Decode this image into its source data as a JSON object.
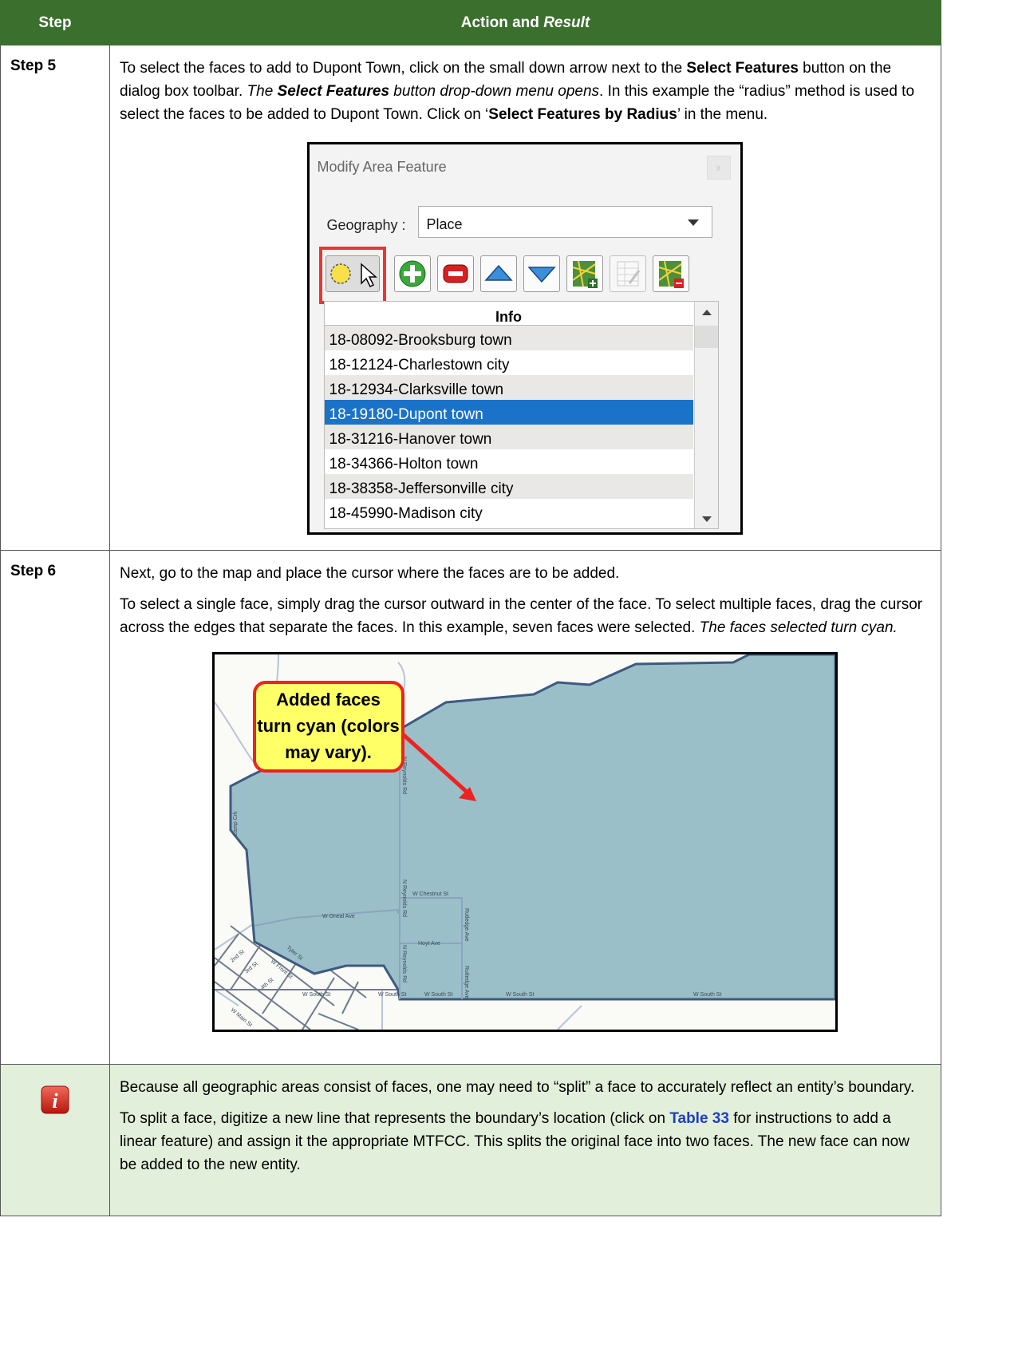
{
  "header": {
    "col_step": "Step",
    "col_action_prefix": "Action and ",
    "col_action_result": "Result"
  },
  "step5": {
    "label": "Step 5",
    "t1": "To select the faces to add to Dupont Town, click on the small down arrow next to the ",
    "b1": "Select Features",
    "t2": " button on the dialog box toolbar. ",
    "i1": "The ",
    "bi1": "Select Features",
    "i2": " button drop-down menu opens",
    "t3": ". In this example the “radius” method is used to select the faces to be added to Dupont Town. Click on ‘",
    "b2": "Select Features by Radius",
    "t4": "’ in the menu."
  },
  "dialog": {
    "title": "Modify Area Feature",
    "close": "x",
    "geo_label": "Geography :",
    "geo_value": "Place",
    "info_header": "Info",
    "items": [
      "18-08092-Brooksburg town",
      "18-12124-Charlestown city",
      "18-12934-Clarksville town",
      "18-19180-Dupont town",
      "18-31216-Hanover town",
      "18-34366-Holton town",
      "18-38358-Jeffersonville city",
      "18-45990-Madison city"
    ]
  },
  "step6": {
    "label": "Step 6",
    "p1": "Next, go to the map and place the cursor where the faces are to be added.",
    "p2": "To select a single face, simply drag the cursor outward in the center of the face. To select multiple faces, drag the cursor across the edges that separate the faces. In this example, seven faces were selected. ",
    "p2_italic": "The faces selected turn cyan."
  },
  "map": {
    "callout_l1": "Added faces",
    "callout_l2": "turn cyan (colors",
    "callout_l3": "may vary).",
    "streets": {
      "chestnut": "W Chestnut St",
      "oneal": "W Oneal Ave",
      "hoyt": "Hoyt Ave",
      "south1": "W South St",
      "south2": "W South St",
      "south3": "W South St",
      "south4": "W South St",
      "reynolds1": "N Reynolds Rd",
      "reynolds2": "N Reynolds Rd",
      "reynolds3": "N Reynolds Rd",
      "rutledge1": "Rutledge Ave",
      "rutledge2": "Rutledge Ave",
      "camp": "Camp Crk",
      "tyler": "Tyler St",
      "main": "W Main St",
      "front": "W Front St",
      "second": "2nd St",
      "third": "3rd St",
      "fourth": "4th St",
      "south_left": "W South St"
    },
    "face_color": "#9bbfc8",
    "outline_color": "#3d5a80"
  },
  "note": {
    "p1": "Because all geographic areas consist of faces, one may need to “split” a face to accurately reflect an entity’s boundary.",
    "p2a": "To split a face, digitize a new line that represents the boundary’s location (click on ",
    "p2_link": "Table 33",
    "p2b": " for instructions to add a linear feature) and assign it the appropriate MTFCC. This splits the original face into two faces. The new face can now be added to the new entity.",
    "icon_letter": "i"
  }
}
